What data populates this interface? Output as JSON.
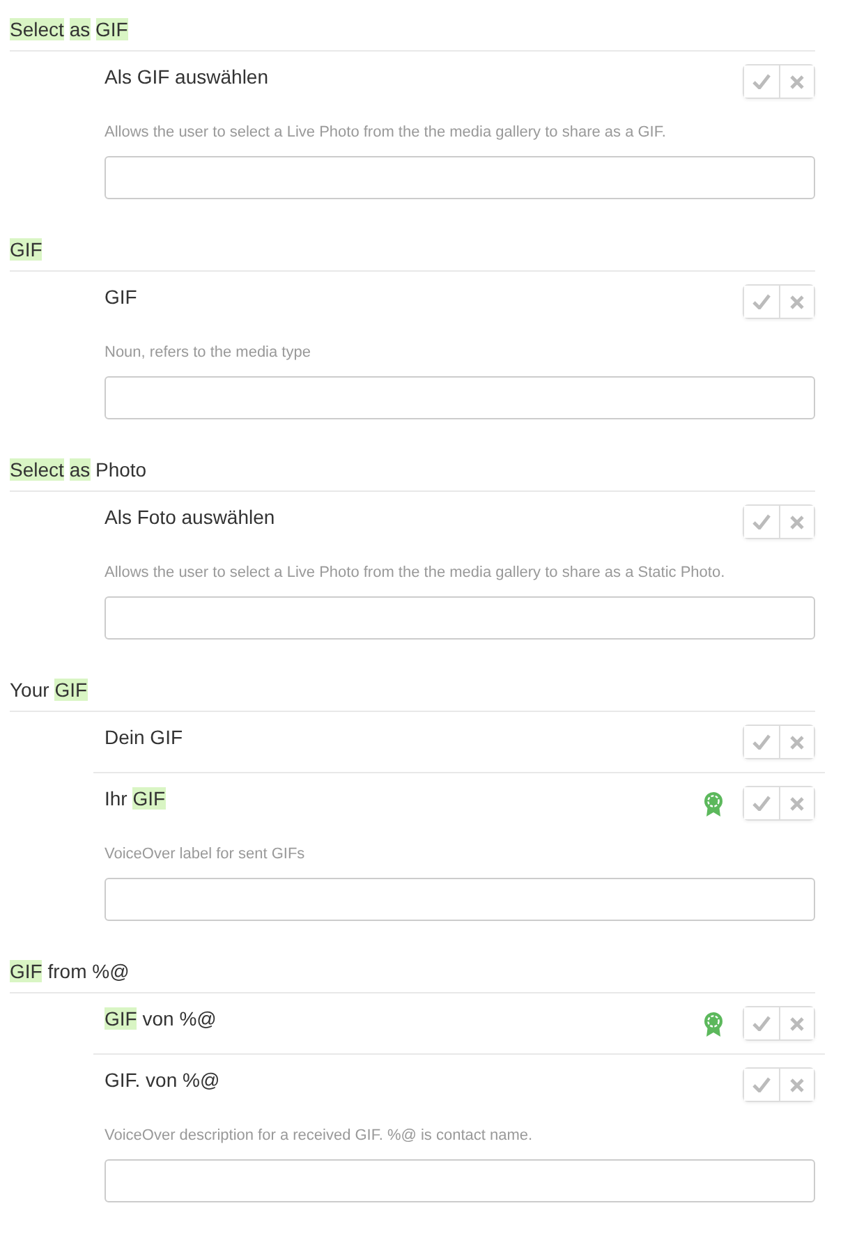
{
  "sections": [
    {
      "title": [
        {
          "text": "Select",
          "highlighted": true
        },
        {
          "text": "as",
          "highlighted": true
        },
        {
          "text": "GIF",
          "highlighted": true
        }
      ],
      "suggestions": [
        {
          "text": [
            {
              "text": "Als GIF auswählen",
              "highlighted": false
            }
          ],
          "approved": false
        }
      ],
      "note": "Allows the user to select a Live Photo from the the media gallery to share as a GIF."
    },
    {
      "title": [
        {
          "text": "GIF",
          "highlighted": true
        }
      ],
      "suggestions": [
        {
          "text": [
            {
              "text": "GIF",
              "highlighted": false
            }
          ],
          "approved": false
        }
      ],
      "note": "Noun, refers to the media type"
    },
    {
      "title": [
        {
          "text": "Select",
          "highlighted": true
        },
        {
          "text": "as",
          "highlighted": true
        },
        {
          "text": "Photo",
          "highlighted": false
        }
      ],
      "suggestions": [
        {
          "text": [
            {
              "text": "Als Foto auswählen",
              "highlighted": false
            }
          ],
          "approved": false
        }
      ],
      "note": "Allows the user to select a Live Photo from the the media gallery to share as a Static Photo."
    },
    {
      "title": [
        {
          "text": "Your",
          "highlighted": false
        },
        {
          "text": "GIF",
          "highlighted": true
        }
      ],
      "suggestions": [
        {
          "text": [
            {
              "text": "Dein GIF",
              "highlighted": false
            }
          ],
          "approved": false
        },
        {
          "text": [
            {
              "text": "Ihr",
              "highlighted": false
            },
            {
              "text": "GIF",
              "highlighted": true
            }
          ],
          "approved": true
        }
      ],
      "note": "VoiceOver label for sent GIFs"
    },
    {
      "title": [
        {
          "text": "GIF",
          "highlighted": true
        },
        {
          "text": "from %@",
          "highlighted": false
        }
      ],
      "suggestions": [
        {
          "text": [
            {
              "text": "GIF",
              "highlighted": true
            },
            {
              "text": "von %@",
              "highlighted": false
            }
          ],
          "approved": true
        },
        {
          "text": [
            {
              "text": "GIF. von %@",
              "highlighted": false
            }
          ],
          "approved": false
        }
      ],
      "note": "VoiceOver description for a received GIF. %@ is contact name."
    }
  ]
}
